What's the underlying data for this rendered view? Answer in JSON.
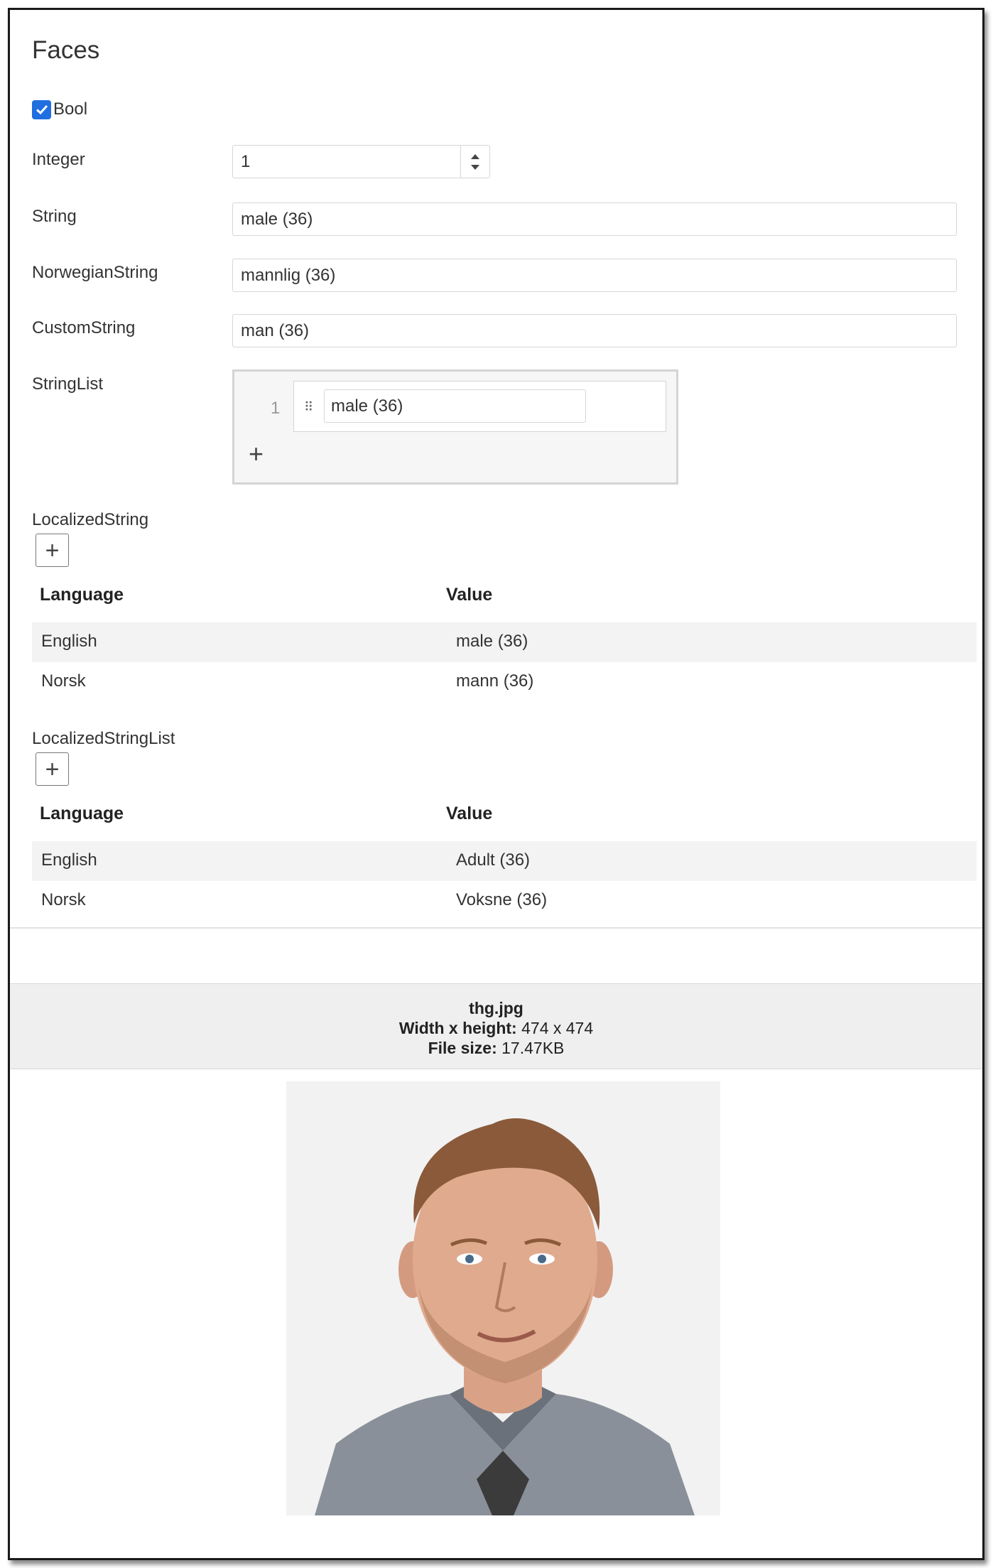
{
  "form": {
    "title": "Faces",
    "bool_label": "Bool",
    "bool_checked": true,
    "integer_label": "Integer",
    "integer_value": "1",
    "string_label": "String",
    "string_value": "male (36)",
    "norwegian_label": "NorwegianString",
    "norwegian_value": "mannlig (36)",
    "custom_label": "CustomString",
    "custom_value": "man (36)",
    "stringlist_label": "StringList",
    "stringlist_items": [
      {
        "index": "1",
        "value": "male (36)"
      }
    ],
    "add_symbol": "+"
  },
  "localized": {
    "label": "LocalizedString",
    "col_language": "Language",
    "col_value": "Value",
    "rows": [
      {
        "language": "English",
        "value": "male (36)"
      },
      {
        "language": "Norsk",
        "value": "mann (36)"
      }
    ]
  },
  "localized_list": {
    "label": "LocalizedStringList",
    "col_language": "Language",
    "col_value": "Value",
    "rows": [
      {
        "language": "English",
        "value": "Adult (36)"
      },
      {
        "language": "Norsk",
        "value": "Voksne (36)"
      }
    ]
  },
  "image_info": {
    "filename": "thg.jpg",
    "dims_label": "Width x height:",
    "dims_value": "474 x 474",
    "size_label": "File size:",
    "size_value": "17.47KB"
  },
  "colors": {
    "checkbox": "#1f6fe0",
    "stripe": "#f3f3f3",
    "info_bar": "#efefef"
  }
}
